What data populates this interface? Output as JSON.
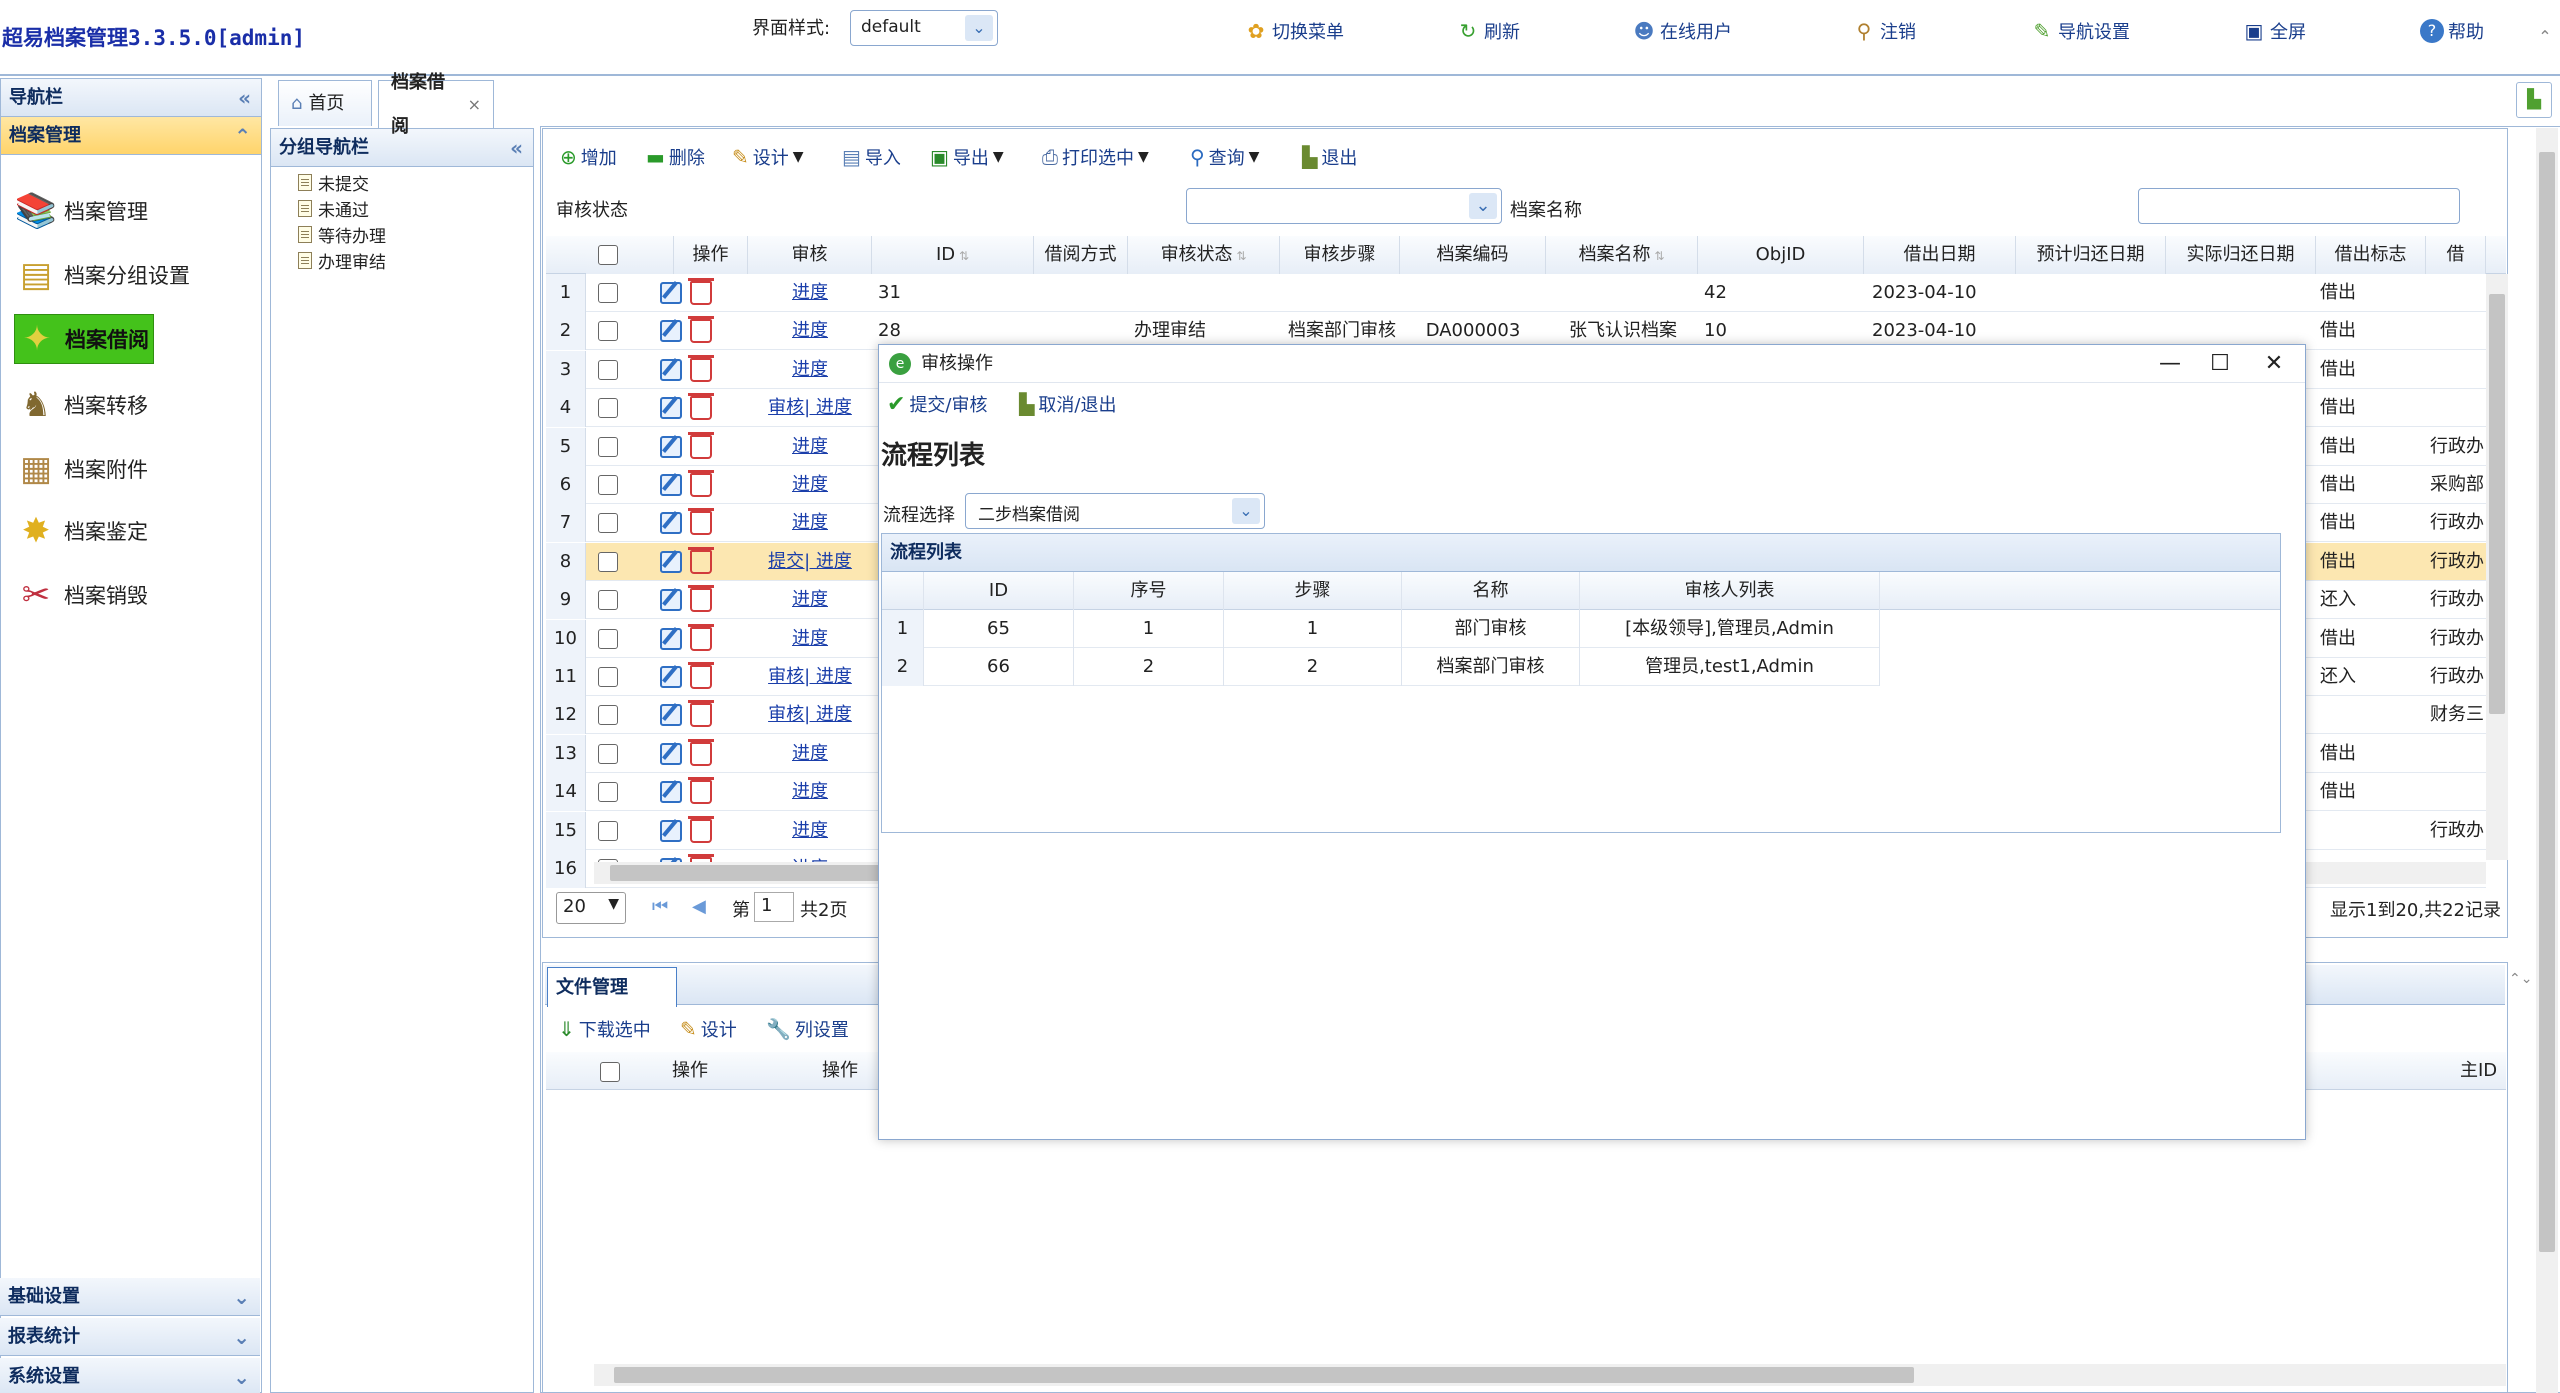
{
  "header": {
    "title": "超易档案管理3.3.5.0[admin]",
    "theme_label": "界面样式:",
    "theme_value": "default",
    "buttons": [
      "切换菜单",
      "刷新",
      "在线用户",
      "注销",
      "导航设置",
      "全屏",
      "帮助"
    ]
  },
  "leftnav": {
    "title": "导航栏",
    "section": "档案管理",
    "items": [
      "档案管理",
      "档案分组设置",
      "档案借阅",
      "档案转移",
      "档案附件",
      "档案鉴定",
      "档案销毁"
    ],
    "bottom": [
      "基础设置",
      "报表统计",
      "系统设置"
    ]
  },
  "groupnav": {
    "title": "分组导航栏",
    "items": [
      "未提交",
      "未通过",
      "等待办理",
      "办理审结"
    ]
  },
  "tabs": [
    "首页",
    "档案借阅"
  ],
  "toolbar": {
    "buttons": [
      "增加",
      "删除",
      "设计",
      "导入",
      "导出",
      "打印选中",
      "查询",
      "退出"
    ],
    "filter_status_label": "审核状态",
    "filter_name_label": "档案名称"
  },
  "grid": {
    "columns": [
      "操作",
      "审核",
      "ID",
      "借阅方式",
      "审核状态",
      "审核步骤",
      "档案编码",
      "档案名称",
      "ObjID",
      "借出日期",
      "预计归还日期",
      "实际归还日期",
      "借出标志",
      "借"
    ],
    "rows": [
      {
        "n": "1",
        "audit": "进度",
        "id": "31",
        "status": "",
        "step": "",
        "code": "",
        "name": "",
        "objid": "42",
        "date": "2023-04-10",
        "flag": "借出",
        "extra": ""
      },
      {
        "n": "2",
        "audit": "进度",
        "id": "28",
        "status": "办理审结",
        "step": "档案部门审核",
        "code": "DA000003",
        "name": "张飞认识档案",
        "objid": "10",
        "date": "2023-04-10",
        "flag": "借出",
        "extra": ""
      },
      {
        "n": "3",
        "audit": "进度",
        "id": "",
        "status": "",
        "step": "",
        "code": "",
        "name": "",
        "objid": "",
        "date": "",
        "flag": "借出",
        "extra": ""
      },
      {
        "n": "4",
        "audit": "审核| 进度",
        "id": "",
        "status": "",
        "step": "",
        "code": "",
        "name": "",
        "objid": "",
        "date": "",
        "flag": "借出",
        "extra": ""
      },
      {
        "n": "5",
        "audit": "进度",
        "id": "",
        "status": "",
        "step": "",
        "code": "",
        "name": "",
        "objid": "",
        "date": "",
        "flag": "借出",
        "extra": "行政办"
      },
      {
        "n": "6",
        "audit": "进度",
        "id": "",
        "status": "",
        "step": "",
        "code": "",
        "name": "",
        "objid": "",
        "date": "",
        "flag": "借出",
        "extra": "采购部"
      },
      {
        "n": "7",
        "audit": "进度",
        "id": "",
        "status": "",
        "step": "",
        "code": "",
        "name": "",
        "objid": "",
        "date": "",
        "flag": "借出",
        "extra": "行政办"
      },
      {
        "n": "8",
        "audit": "提交| 进度",
        "id": "",
        "status": "",
        "step": "",
        "code": "",
        "name": "",
        "objid": "",
        "date": "",
        "flag": "借出",
        "extra": "行政办"
      },
      {
        "n": "9",
        "audit": "进度",
        "id": "",
        "status": "",
        "step": "",
        "code": "",
        "name": "",
        "objid": "",
        "date": "",
        "flag": "还入",
        "extra": "行政办"
      },
      {
        "n": "10",
        "audit": "进度",
        "id": "",
        "status": "",
        "step": "",
        "code": "",
        "name": "",
        "objid": "",
        "date": "",
        "flag": "借出",
        "extra": "行政办"
      },
      {
        "n": "11",
        "audit": "审核| 进度",
        "id": "",
        "status": "",
        "step": "",
        "code": "",
        "name": "",
        "objid": "",
        "date": "",
        "flag": "还入",
        "extra": "行政办"
      },
      {
        "n": "12",
        "audit": "审核| 进度",
        "id": "",
        "status": "",
        "step": "",
        "code": "",
        "name": "",
        "objid": "",
        "date": "",
        "flag": "",
        "extra": "财务三"
      },
      {
        "n": "13",
        "audit": "进度",
        "id": "",
        "status": "",
        "step": "",
        "code": "",
        "name": "",
        "objid": "",
        "date": "",
        "flag": "借出",
        "extra": ""
      },
      {
        "n": "14",
        "audit": "进度",
        "id": "",
        "status": "",
        "step": "",
        "code": "",
        "name": "",
        "objid": "",
        "date": "",
        "flag": "借出",
        "extra": ""
      },
      {
        "n": "15",
        "audit": "进度",
        "id": "",
        "status": "",
        "step": "",
        "code": "",
        "name": "",
        "objid": "",
        "date": "",
        "flag": "",
        "extra": "行政办"
      },
      {
        "n": "16",
        "audit": "进度",
        "id": "",
        "status": "",
        "step": "",
        "code": "",
        "name": "",
        "objid": "",
        "date": "",
        "flag": "",
        "extra": ""
      }
    ]
  },
  "pager": {
    "page_size": "20",
    "page_prefix": "第",
    "page_value": "1",
    "page_total": "共2页",
    "summary": "显示1到20,共22记录"
  },
  "files": {
    "tab": "文件管理",
    "buttons": [
      "下载选中",
      "设计",
      "列设置"
    ],
    "columns": [
      "操作",
      "操作",
      "主ID"
    ]
  },
  "dialog": {
    "title": "审核操作",
    "actions": [
      "提交/审核",
      "取消/退出"
    ],
    "heading": "流程列表",
    "flow_label": "流程选择",
    "flow_value": "二步档案借阅",
    "grid_title": "流程列表",
    "columns": [
      "ID",
      "序号",
      "步骤",
      "名称",
      "审核人列表"
    ],
    "rows": [
      {
        "n": "1",
        "id": "65",
        "seq": "1",
        "step": "1",
        "name": "部门审核",
        "auditors": "[本级领导],管理员,Admin"
      },
      {
        "n": "2",
        "id": "66",
        "seq": "2",
        "step": "2",
        "name": "档案部门审核",
        "auditors": "管理员,test1,Admin"
      }
    ]
  }
}
